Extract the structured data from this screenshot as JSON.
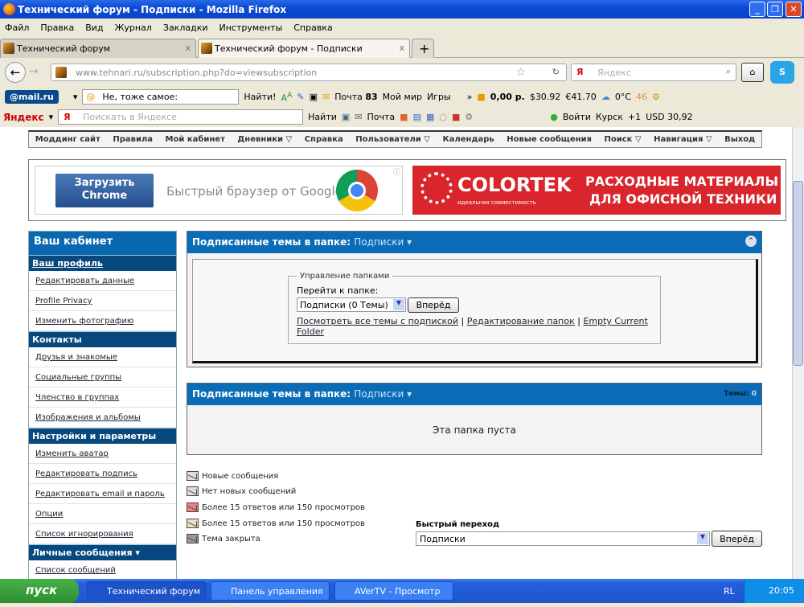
{
  "window": {
    "title": "Технический форум - Подписки - Mozilla Firefox"
  },
  "menu": [
    "Файл",
    "Правка",
    "Вид",
    "Журнал",
    "Закладки",
    "Инструменты",
    "Справка"
  ],
  "tabs": [
    {
      "label": "Технический форум"
    },
    {
      "label": "Технический форум - Подписки"
    }
  ],
  "url": "www.tehnari.ru/subscription.php?do=viewsubscription",
  "search_placeholder": "Яндекс",
  "mailru": {
    "logo": "@mail.ru",
    "search_value": "Не, тоже самое:",
    "find": "Найти!",
    "mail": "Почта",
    "mail_count": "83",
    "myworld": "Мой мир",
    "games": "Игры",
    "balance": "0,00 р.",
    "usd": "30.92",
    "eur": "41.70",
    "weather": "0°C",
    "count": "46"
  },
  "yandex": {
    "logo": "Яндекс",
    "placeholder": "Поискать в Яндексе",
    "find": "Найти",
    "mail": "Почта",
    "login": "Войти",
    "city": "Курск",
    "plus": "+1",
    "usd": "USD 30,92"
  },
  "nav": [
    "Моддинг сайт",
    "Правила",
    "Мой кабинет",
    "Дневники ▽",
    "Справка",
    "Пользователи ▽",
    "Календарь",
    "Новые сообщения",
    "Поиск ▽",
    "Навигация ▽",
    "Выход"
  ],
  "ads": {
    "chrome_button": "Загрузить Chrome",
    "chrome_text": "Быстрый браузер от Google",
    "colortek_brand": "COLORTEK",
    "colortek_sub": "идеальная совместимость",
    "colortek_text1": "РАСХОДНЫЕ МАТЕРИАЛЫ",
    "colortek_text2": "ДЛЯ ОФИСНОЙ ТЕХНИКИ"
  },
  "sidebar": {
    "title": "Ваш кабинет",
    "sections": [
      {
        "title": "Ваш профиль",
        "items": [
          "Редактировать данные",
          "Profile Privacy",
          "Изменить фотографию"
        ]
      },
      {
        "title": "Контакты",
        "items": [
          "Друзья и знакомые",
          "Социальные группы",
          "Членство в группах",
          "Изображения и альбомы"
        ]
      },
      {
        "title": "Настройки и параметры",
        "items": [
          "Изменить аватар",
          "Редактировать подпись",
          "Редактировать email и пароль",
          "Опции",
          "Список игнорирования"
        ]
      },
      {
        "title": "Личные сообщения ▾",
        "items": [
          "Список сообщений"
        ]
      }
    ]
  },
  "panel1": {
    "title": "Подписанные темы в папке:",
    "folder": "Подписки ▾",
    "legend": "Управление папками",
    "goto_label": "Перейти к папке:",
    "select": "Подписки (0 Темы)",
    "go": "Вперёд",
    "link1": "Посмотреть все темы с подпиской",
    "link2": "Редактирование папок",
    "link3": "Empty Current Folder"
  },
  "panel2": {
    "title": "Подписанные темы в папке:",
    "folder": "Подписки ▾",
    "count_label": "Темы:",
    "count": "0",
    "empty": "Эта папка пуста"
  },
  "legend": [
    "Новые сообщения",
    "Нет новых сообщений",
    "Более 15 ответов или 150 просмотров",
    "Более 15 ответов или 150 просмотров",
    "Тема закрыта"
  ],
  "quickjump": {
    "label": "Быстрый переход",
    "value": "Подписки",
    "go": "Вперёд"
  },
  "taskbar": {
    "start": "пуск",
    "tasks": [
      "Технический форум ...",
      "Панель управления ...",
      "AVerTV - Просмотр"
    ],
    "lang": "RL",
    "time": "20:05"
  }
}
